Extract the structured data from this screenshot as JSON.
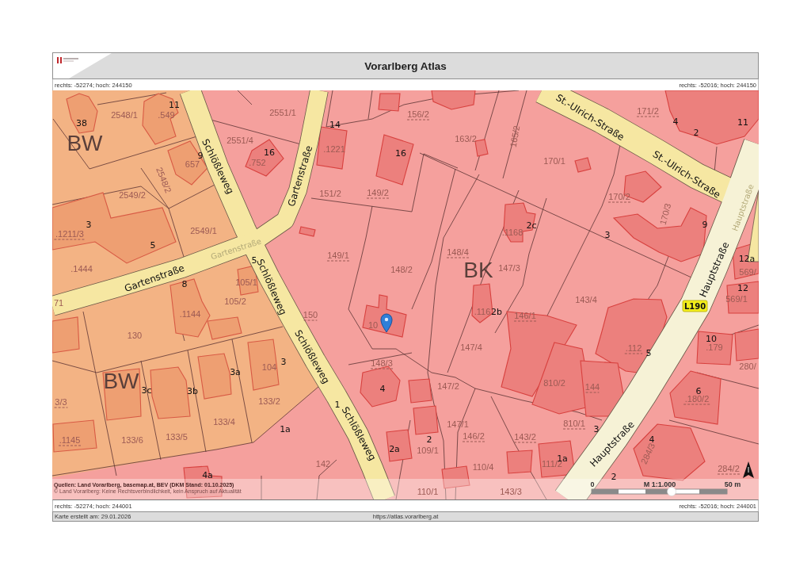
{
  "header": {
    "title": "Vorarlberg Atlas"
  },
  "coordinates_top": {
    "left": "rechts: -52274; hoch: 244150",
    "right": "rechts: -52016; hoch: 244150"
  },
  "map": {
    "zones": [
      "BW",
      "BK",
      "BW"
    ],
    "streets": [
      {
        "text": "St.-Ulrich-Straße",
        "kind": "primary"
      },
      {
        "text": "Schlößleweg",
        "kind": "primary"
      },
      {
        "text": "Gartenstraße",
        "kind": "primary"
      },
      {
        "text": "St.-Ulrich-Straße",
        "kind": "primary"
      },
      {
        "text": "Hauptstraße",
        "kind": "faint"
      },
      {
        "text": "Gartenstraße",
        "kind": "faint"
      },
      {
        "text": "Gartenstraße",
        "kind": "primary"
      },
      {
        "text": "Schlößleweg",
        "kind": "primary"
      },
      {
        "text": "Hauptstraße",
        "kind": "primary"
      },
      {
        "text": "Schlößleweg",
        "kind": "primary"
      },
      {
        "text": "Schlößleweg",
        "kind": "primary"
      },
      {
        "text": "Hauptstraße",
        "kind": "primary"
      }
    ],
    "parcels": [
      {
        "text": "2548/1",
        "underlined": false
      },
      {
        "text": ".549",
        "underlined": false
      },
      {
        "text": "2551/1",
        "underlined": false
      },
      {
        "text": "156/2",
        "underlined": true
      },
      {
        "text": "171/2",
        "underlined": true
      },
      {
        "text": "2551/4",
        "underlined": false
      },
      {
        "text": "163/2",
        "underlined": false
      },
      {
        "text": "165/2",
        "underlined": false
      },
      {
        "text": ".1221",
        "underlined": false
      },
      {
        "text": "657",
        "underlined": false
      },
      {
        "text": ".752",
        "underlined": false
      },
      {
        "text": "170/1",
        "underlined": false
      },
      {
        "text": "2548/2",
        "underlined": false
      },
      {
        "text": "2549/2",
        "underlined": false
      },
      {
        "text": "151/2",
        "underlined": false
      },
      {
        "text": "149/2",
        "underlined": true
      },
      {
        "text": "170/2",
        "underlined": true
      },
      {
        "text": "170/3",
        "underlined": false
      },
      {
        "text": ".1211/3",
        "underlined": true
      },
      {
        "text": "2549/1",
        "underlined": false
      },
      {
        "text": ".1168",
        "underlined": false
      },
      {
        "text": "149/1",
        "underlined": true
      },
      {
        "text": "148/4",
        "underlined": true
      },
      {
        "text": ".1444",
        "underlined": false
      },
      {
        "text": "148/2",
        "underlined": false
      },
      {
        "text": "147/3",
        "underlined": false
      },
      {
        "text": "569/",
        "underlined": false
      },
      {
        "text": "105/1",
        "underlined": false
      },
      {
        "text": "71",
        "underlined": false
      },
      {
        "text": "105/2",
        "underlined": false
      },
      {
        "text": "143/4",
        "underlined": false
      },
      {
        "text": "569/1",
        "underlined": false
      },
      {
        "text": ".1144",
        "underlined": false
      },
      {
        "text": "150",
        "underlined": true
      },
      {
        "text": ".116",
        "underlined": false
      },
      {
        "text": "146/1",
        "underlined": true
      },
      {
        "text": "10",
        "underlined": false
      },
      {
        "text": "130",
        "underlined": false
      },
      {
        "text": "147/4",
        "underlined": false
      },
      {
        "text": ".112",
        "underlined": true
      },
      {
        "text": ".179",
        "underlined": false
      },
      {
        "text": "104",
        "underlined": false
      },
      {
        "text": "148/3",
        "underlined": true
      },
      {
        "text": "280/",
        "underlined": false
      },
      {
        "text": "147/2",
        "underlined": false
      },
      {
        "text": "810/2",
        "underlined": false
      },
      {
        "text": "144",
        "underlined": true
      },
      {
        "text": "3/3",
        "underlined": true
      },
      {
        "text": "133/2",
        "underlined": false
      },
      {
        "text": ".180/2",
        "underlined": true
      },
      {
        "text": "133/4",
        "underlined": false
      },
      {
        "text": "147/1",
        "underlined": false
      },
      {
        "text": "810/1",
        "underlined": true
      },
      {
        "text": ".1145",
        "underlined": true
      },
      {
        "text": "133/6",
        "underlined": false
      },
      {
        "text": "133/5",
        "underlined": false
      },
      {
        "text": "146/2",
        "underlined": true
      },
      {
        "text": "143/2",
        "underlined": true
      },
      {
        "text": "109/1",
        "underlined": false
      },
      {
        "text": "284/3",
        "underlined": false
      },
      {
        "text": "142",
        "underlined": false
      },
      {
        "text": "110/4",
        "underlined": false
      },
      {
        "text": "111/2",
        "underlined": false
      },
      {
        "text": "284/2",
        "underlined": true
      },
      {
        "text": "110/1",
        "underlined": false
      },
      {
        "text": "143/3",
        "underlined": false
      }
    ],
    "house_numbers": [
      "11",
      "38",
      "14",
      "4",
      "11",
      "2",
      "9",
      "16",
      "16",
      "3",
      "2c",
      "9",
      "3",
      "5",
      "5",
      "12a",
      "8",
      "12",
      "2b",
      "10",
      "5",
      "3",
      "3a",
      "3c",
      "3b",
      "4",
      "6",
      "1",
      "1a",
      "3",
      "2",
      "4",
      "2a",
      "1a",
      "4a",
      "2"
    ],
    "road_sign": "L190",
    "sources": "Quellen: Land Vorarlberg, basemap.at, BEV (DKM Stand: 01.10.2025)",
    "disclaimer": "© Land Vorarlberg: Keine Rechtsverbindlichkeit, kein Anspruch auf Aktualität",
    "scale": {
      "start": "0",
      "ratio": "M 1:1.000",
      "end": "50 m"
    }
  },
  "coordinates_bottom": {
    "left": "rechts: -52274; hoch: 244001",
    "right": "rechts: -52016; hoch: 244001"
  },
  "footer": {
    "created": "Karte erstellt am: 29.01.2026",
    "url": "https://atlas.vorarlberg.at"
  }
}
